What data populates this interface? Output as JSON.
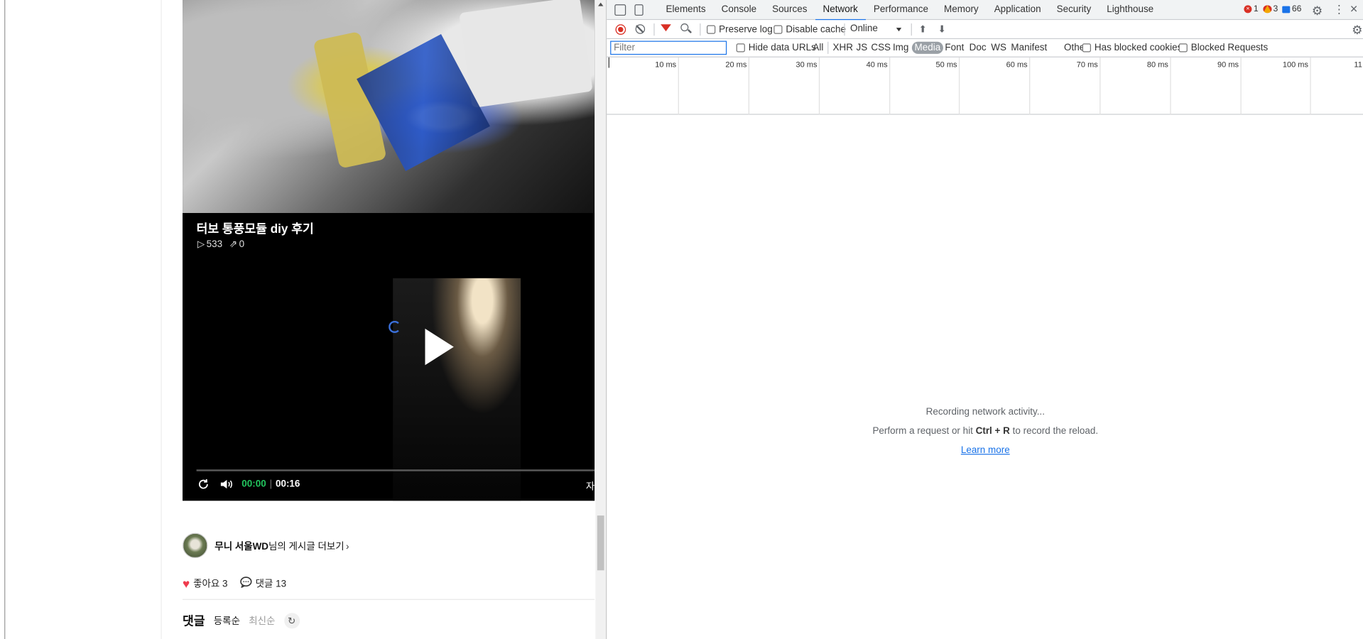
{
  "page": {
    "video": {
      "title": "터보 통풍모듈 diy 후기",
      "plays": "533",
      "shares": "0",
      "time_current": "00:00",
      "time_total": "00:16",
      "auto_label": "자"
    },
    "author": {
      "name": "무니 서울WD",
      "suffix": "님의 게시글 더보기"
    },
    "reactions": {
      "likes_label": "좋아요 3",
      "comments_label": "댓글 13"
    },
    "comments": {
      "title": "댓글",
      "sort_registered": "등록순",
      "sort_latest": "최신순"
    }
  },
  "devtools": {
    "tabs": [
      "Elements",
      "Console",
      "Sources",
      "Network",
      "Performance",
      "Memory",
      "Application",
      "Security",
      "Lighthouse"
    ],
    "active_tab": "Network",
    "badges": {
      "errors": "1",
      "warnings": "3",
      "messages": "66"
    },
    "toolbar": {
      "preserve_log": "Preserve log",
      "disable_cache": "Disable cache",
      "throttle": "Online"
    },
    "filter": {
      "placeholder": "Filter",
      "hide_data_urls": "Hide data URLs",
      "types": [
        "All",
        "XHR",
        "JS",
        "CSS",
        "Img",
        "Media",
        "Font",
        "Doc",
        "WS",
        "Manifest",
        "Other"
      ],
      "active_type": "Media",
      "has_blocked_cookies": "Has blocked cookies",
      "blocked_requests": "Blocked Requests"
    },
    "timeline_ticks": [
      "10 ms",
      "20 ms",
      "30 ms",
      "40 ms",
      "50 ms",
      "60 ms",
      "70 ms",
      "80 ms",
      "90 ms",
      "100 ms",
      "11"
    ],
    "empty_state": {
      "line1": "Recording network activity...",
      "line2_prefix": "Perform a request or hit ",
      "shortcut": "Ctrl + R",
      "line2_suffix": " to record the reload.",
      "link": "Learn more"
    },
    "colors": {
      "accent": "#1a73e8",
      "record": "#d93025",
      "played": "#22c55e"
    }
  }
}
